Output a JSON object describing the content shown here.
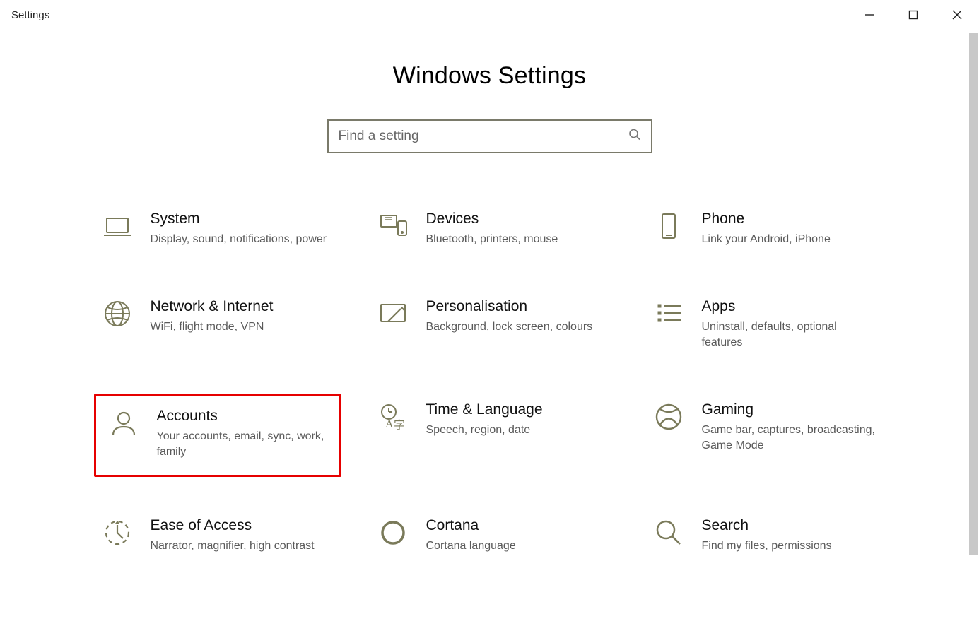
{
  "window": {
    "title": "Settings"
  },
  "header": {
    "page_title": "Windows Settings"
  },
  "search": {
    "placeholder": "Find a setting"
  },
  "tiles": [
    {
      "title": "System",
      "desc": "Display, sound, notifications, power",
      "icon": "laptop",
      "highlighted": false
    },
    {
      "title": "Devices",
      "desc": "Bluetooth, printers, mouse",
      "icon": "devices",
      "highlighted": false
    },
    {
      "title": "Phone",
      "desc": "Link your Android, iPhone",
      "icon": "phone",
      "highlighted": false
    },
    {
      "title": "Network & Internet",
      "desc": "WiFi, flight mode, VPN",
      "icon": "globe",
      "highlighted": false
    },
    {
      "title": "Personalisation",
      "desc": "Background, lock screen, colours",
      "icon": "personalise",
      "highlighted": false
    },
    {
      "title": "Apps",
      "desc": "Uninstall, defaults, optional features",
      "icon": "apps",
      "highlighted": false
    },
    {
      "title": "Accounts",
      "desc": "Your accounts, email, sync, work, family",
      "icon": "person",
      "highlighted": true
    },
    {
      "title": "Time & Language",
      "desc": "Speech, region, date",
      "icon": "timelang",
      "highlighted": false
    },
    {
      "title": "Gaming",
      "desc": "Game bar, captures, broadcasting, Game Mode",
      "icon": "xbox",
      "highlighted": false
    },
    {
      "title": "Ease of Access",
      "desc": "Narrator, magnifier, high contrast",
      "icon": "ease",
      "highlighted": false
    },
    {
      "title": "Cortana",
      "desc": "Cortana language",
      "icon": "cortana",
      "highlighted": false
    },
    {
      "title": "Search",
      "desc": "Find my files, permissions",
      "icon": "magnify",
      "highlighted": false
    }
  ]
}
